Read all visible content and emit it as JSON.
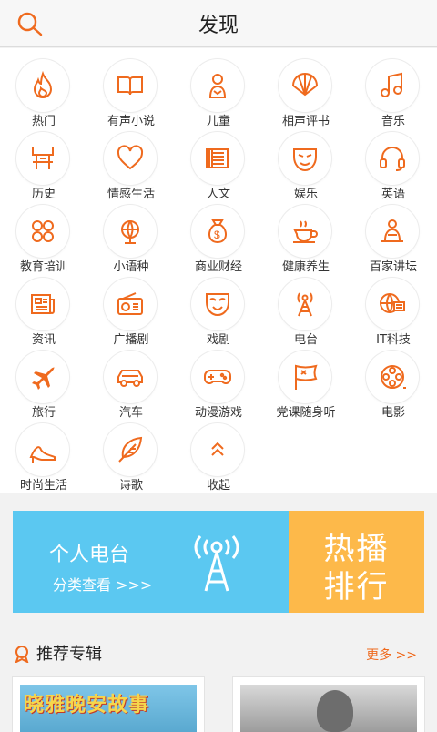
{
  "header": {
    "title": "发现"
  },
  "categories": [
    {
      "label": "热门",
      "icon": "fire-icon"
    },
    {
      "label": "有声小说",
      "icon": "book-icon"
    },
    {
      "label": "儿童",
      "icon": "child-icon"
    },
    {
      "label": "相声评书",
      "icon": "fan-icon"
    },
    {
      "label": "音乐",
      "icon": "music-note-icon"
    },
    {
      "label": "历史",
      "icon": "history-icon"
    },
    {
      "label": "情感生活",
      "icon": "heart-icon"
    },
    {
      "label": "人文",
      "icon": "scroll-icon"
    },
    {
      "label": "娱乐",
      "icon": "mask-icon"
    },
    {
      "label": "英语",
      "icon": "headset-icon"
    },
    {
      "label": "教育培训",
      "icon": "education-icon"
    },
    {
      "label": "小语种",
      "icon": "globe-icon"
    },
    {
      "label": "商业财经",
      "icon": "money-bag-icon"
    },
    {
      "label": "健康养生",
      "icon": "tea-cup-icon"
    },
    {
      "label": "百家讲坛",
      "icon": "lecture-icon"
    },
    {
      "label": "资讯",
      "icon": "newspaper-icon"
    },
    {
      "label": "广播剧",
      "icon": "radio-icon"
    },
    {
      "label": "戏剧",
      "icon": "opera-mask-icon"
    },
    {
      "label": "电台",
      "icon": "radio-tower-icon"
    },
    {
      "label": "IT科技",
      "icon": "it-tech-icon"
    },
    {
      "label": "旅行",
      "icon": "airplane-icon"
    },
    {
      "label": "汽车",
      "icon": "car-icon"
    },
    {
      "label": "动漫游戏",
      "icon": "gamepad-icon"
    },
    {
      "label": "党课随身听",
      "icon": "flag-icon"
    },
    {
      "label": "电影",
      "icon": "film-reel-icon"
    },
    {
      "label": "时尚生活",
      "icon": "high-heel-icon"
    },
    {
      "label": "诗歌",
      "icon": "feather-icon"
    },
    {
      "label": "收起",
      "icon": "chevron-up-icon"
    }
  ],
  "banner": {
    "left_title": "个人电台",
    "left_sub": "分类查看 >>>",
    "right_line1": "热播",
    "right_line2": "排行"
  },
  "recommend": {
    "title": "推荐专辑",
    "more": "更多 >>",
    "album1_text": "晓雅晚安故事"
  },
  "colors": {
    "accent": "#ef6a1e",
    "banner_blue": "#5bc8f1",
    "banner_orange": "#fdb94a"
  }
}
